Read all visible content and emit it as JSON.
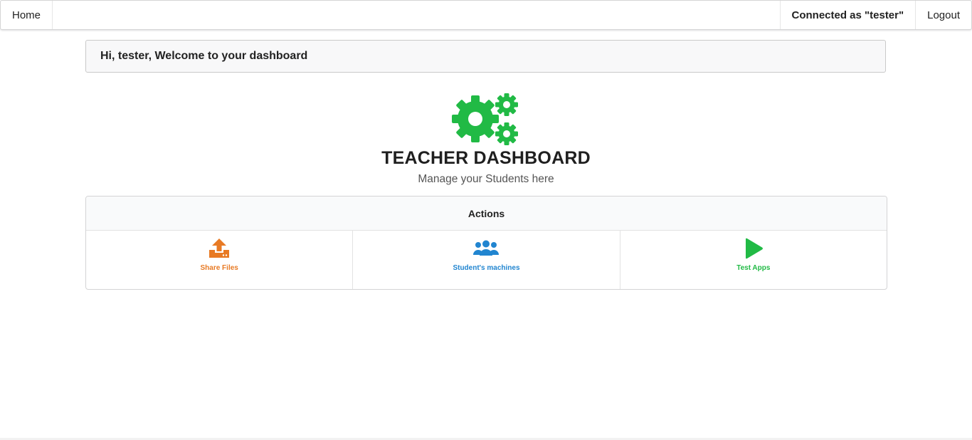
{
  "nav": {
    "home_label": "Home",
    "connected_label": "Connected as \"tester\"",
    "logout_label": "Logout"
  },
  "welcome": {
    "message": "Hi, tester, Welcome to your dashboard"
  },
  "hero": {
    "icon": "gears-icon",
    "title": "TEACHER DASHBOARD",
    "subtitle": "Manage your Students here",
    "color": "#21ba45"
  },
  "actions": {
    "header": "Actions",
    "items": [
      {
        "label": "Share Files",
        "icon": "upload-icon",
        "color": "#e87a24"
      },
      {
        "label": "Student's machines",
        "icon": "users-icon",
        "color": "#2185d0"
      },
      {
        "label": "Test Apps",
        "icon": "play-icon",
        "color": "#21ba45"
      }
    ]
  }
}
